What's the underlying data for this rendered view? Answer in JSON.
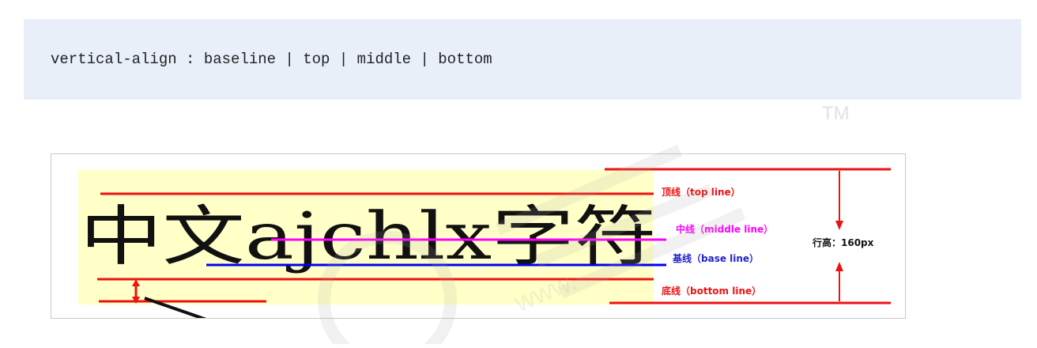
{
  "code": {
    "text": "vertical-align : baseline | top | middle | bottom"
  },
  "diagram": {
    "sample_text": "中文ajchlx字符",
    "labels": {
      "top_line": "顶线（top line）",
      "middle_line": "中线（middle line）",
      "base_line": "基线（base line）",
      "bottom_line": "底线（bottom line）",
      "line_height": "行高：160px"
    },
    "colors": {
      "highlight": "#ffffc8",
      "line_red": "#ee1111",
      "middle_line": "#ff00ff",
      "base_line": "#0000ee",
      "label_blue": "#2222cc",
      "text": "#111111"
    }
  },
  "watermark": {
    "brand_text": "",
    "url_text": "www.",
    "tm": "TM"
  }
}
